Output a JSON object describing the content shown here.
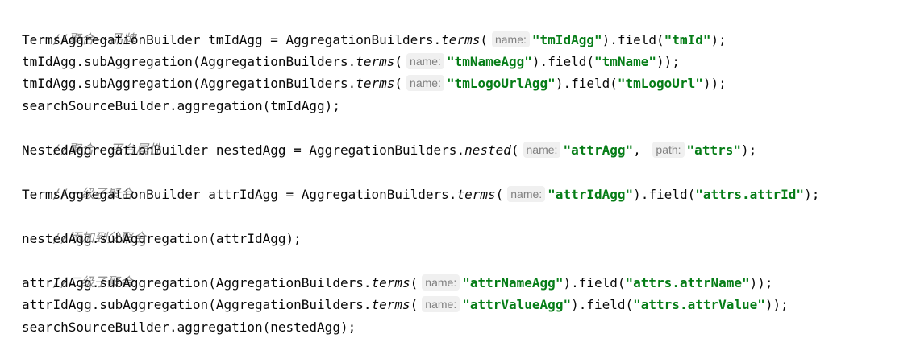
{
  "code": {
    "l1": {
      "comment": "//聚合--品牌"
    },
    "l2": {
      "a": "TermsAggregationBuilder tmIdAgg = AggregationBuilders.",
      "m": "terms",
      "b": "(",
      "hint": "name:",
      "s1": "\"tmIdAgg\"",
      "c": ").field(",
      "s2": "\"tmId\"",
      "d": ");"
    },
    "l3": {
      "a": "tmIdAgg.subAggregation(AggregationBuilders.",
      "m": "terms",
      "b": "(",
      "hint": "name:",
      "s1": "\"tmNameAgg\"",
      "c": ").field(",
      "s2": "\"tmName\"",
      "d": "));"
    },
    "l4": {
      "a": "tmIdAgg.subAggregation(AggregationBuilders.",
      "m": "terms",
      "b": "(",
      "hint": "name:",
      "s1": "\"tmLogoUrlAgg\"",
      "c": ").field(",
      "s2": "\"tmLogoUrl\"",
      "d": "));"
    },
    "l5": {
      "a": "searchSourceBuilder.aggregation(tmIdAgg);"
    },
    "l6": {
      "comment": "//聚合--平台属性"
    },
    "l7": {
      "a": "NestedAggregationBuilder nestedAgg = AggregationBuilders.",
      "m": "nested",
      "b": "(",
      "hint": "name:",
      "s1": "\"attrAgg\"",
      "c": ", ",
      "hint2": "path:",
      "s2": "\"attrs\"",
      "d": ");"
    },
    "l8": {
      "comment": "//一级子聚合"
    },
    "l9": {
      "a": "TermsAggregationBuilder attrIdAgg = AggregationBuilders.",
      "m": "terms",
      "b": "(",
      "hint": "name:",
      "s1": "\"attrIdAgg\"",
      "c": ").field(",
      "s2": "\"attrs.attrId\"",
      "d": ");"
    },
    "l10": {
      "comment": "//添加到父聚合"
    },
    "l11": {
      "a": "nestedAgg.subAggregation(attrIdAgg);"
    },
    "l12": {
      "comment": "//二级子聚合"
    },
    "l13": {
      "a": "attrIdAgg.subAggregation(AggregationBuilders.",
      "m": "terms",
      "b": "(",
      "hint": "name:",
      "s1": "\"attrNameAgg\"",
      "c": ").field(",
      "s2": "\"attrs.attrName\"",
      "d": "));"
    },
    "l14": {
      "a": "attrIdAgg.subAggregation(AggregationBuilders.",
      "m": "terms",
      "b": "(",
      "hint": "name:",
      "s1": "\"attrValueAgg\"",
      "c": ").field(",
      "s2": "\"attrs.attrValue\"",
      "d": "));"
    },
    "l15": {
      "a": "searchSourceBuilder.aggregation(nestedAgg);"
    }
  }
}
